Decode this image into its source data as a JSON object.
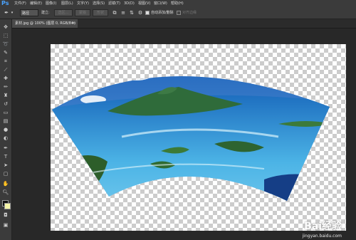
{
  "app": {
    "logo": "Ps"
  },
  "menu": [
    "文件(F)",
    "编辑(E)",
    "图像(I)",
    "图层(L)",
    "文字(Y)",
    "选择(S)",
    "滤镜(T)",
    "3D(D)",
    "视图(V)",
    "窗口(W)",
    "帮助(H)"
  ],
  "options": {
    "mode_value": "路径",
    "make_label": "建立:",
    "selection_btn": "选区...",
    "mask_btn": "蒙版",
    "shape_btn": "形状",
    "autoadd_label": "自动添加/删除",
    "align_label": "对齐边缘"
  },
  "tools": [
    "move-icon",
    "marquee-icon",
    "lasso-icon",
    "quick-select-icon",
    "crop-icon",
    "eyedropper-icon",
    "healing-icon",
    "brush-icon",
    "stamp-icon",
    "history-brush-icon",
    "eraser-icon",
    "gradient-icon",
    "blur-icon",
    "dodge-icon",
    "pen-icon",
    "type-icon",
    "path-select-icon",
    "shape-icon",
    "hand-icon",
    "zoom-icon"
  ],
  "document": {
    "tab_title": "素材.jpg @ 100% (图层 0, RGB/8#) *"
  },
  "watermark": {
    "text": "Bai经验",
    "sub": "jingyan.baidu.com"
  },
  "colors": {
    "bg": "#282828",
    "panel": "#3b3b3b",
    "sea": "#1e7fc8",
    "sky": "#3a78c9"
  }
}
